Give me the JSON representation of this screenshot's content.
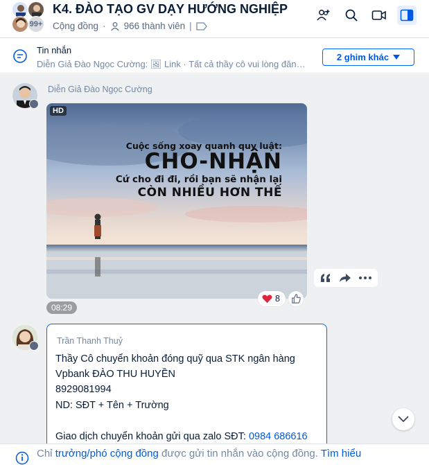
{
  "header": {
    "title": "K4. ĐÀO TẠO GV DẠY HƯỚNG NGHIỆP",
    "avatar_count": "99+",
    "type_label": "Cộng đồng",
    "members": "966 thành viên",
    "icons": [
      "add-member-icon",
      "search-icon",
      "video-call-icon",
      "sidebar-toggle-icon"
    ]
  },
  "pinned": {
    "title": "Tin nhắn",
    "text": "Diễn Giả Đào Ngọc Cường: 🖼 Link · Tất cả thầy cô vui lòng đăng k...",
    "more_button": "2 ghim khác"
  },
  "messages": [
    {
      "sender": "Diễn Giả Đào Ngọc Cường",
      "type": "image",
      "badge": "HD",
      "image_text": [
        "Cuộc sống xoay quanh quy luật:",
        "CHO-NHẬN",
        "Cứ cho đi đi, rồi bạn sẽ nhận lại",
        "CÒN NHIỀU HƠN THẾ"
      ],
      "time": "08:29",
      "reaction_count": "8"
    },
    {
      "sender": "Trần Thanh Thuỷ",
      "lines": [
        "Thầy Cô chuyển khoản đóng quỹ qua STK ngân hàng",
        "Vpbank ĐÀO THU HUYỀN",
        "8929081994",
        "ND: SĐT + Tên + Trường"
      ],
      "last_line_prefix": "Giao dịch chuyển khoản gửi qua zalo SĐT: ",
      "last_line_phone": "0984 686616"
    }
  ],
  "footer": {
    "prefix": "Chỉ ",
    "link1": "trưởng/phó cộng đồng",
    "middle": " được gửi tin nhắn vào cộng đồng. ",
    "link2": "Tìm hiểu"
  },
  "colors": {
    "accent": "#0068ff",
    "chat_bg": "#eef0f1",
    "text": "#081c36",
    "muted": "#7589a3"
  }
}
